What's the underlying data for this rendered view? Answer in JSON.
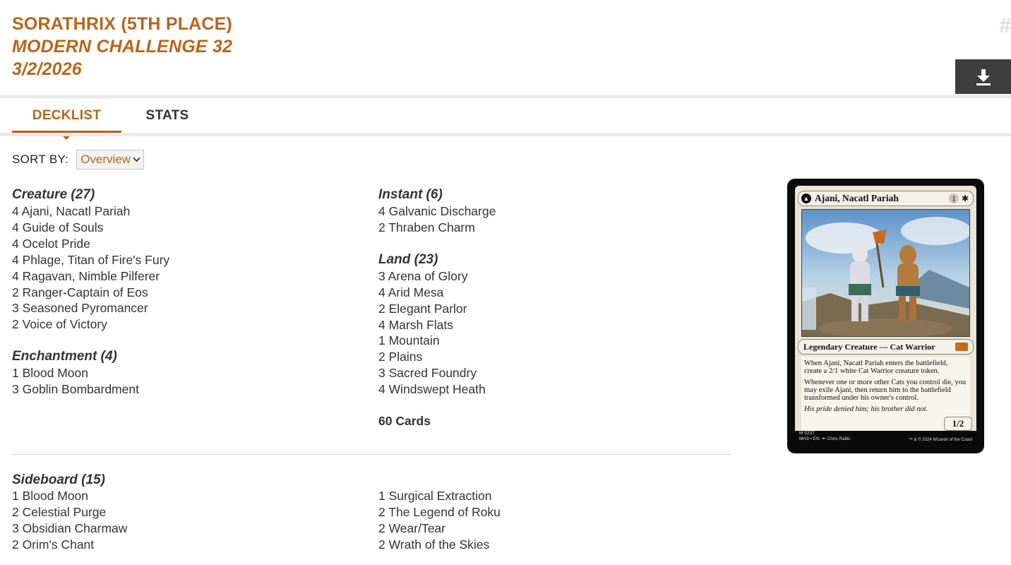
{
  "header": {
    "player": "SORATHRIX (5TH PLACE)",
    "event": "MODERN CHALLENGE 32",
    "date": "3/2/2026",
    "hash": "#"
  },
  "tabs": [
    {
      "label": "DECKLIST",
      "active": true
    },
    {
      "label": "STATS",
      "active": false
    }
  ],
  "sort": {
    "label": "SORT BY:",
    "selected": "Overview"
  },
  "maindeck": {
    "column1": [
      {
        "title": "Creature (27)",
        "cards": [
          "4 Ajani, Nacatl Pariah",
          "4 Guide of Souls",
          "4 Ocelot Pride",
          "4 Phlage, Titan of Fire's Fury",
          "4 Ragavan, Nimble Pilferer",
          "2 Ranger-Captain of Eos",
          "3 Seasoned Pyromancer",
          "2 Voice of Victory"
        ]
      },
      {
        "title": "Enchantment (4)",
        "cards": [
          "1 Blood Moon",
          "3 Goblin Bombardment"
        ]
      }
    ],
    "column2": [
      {
        "title": "Instant (6)",
        "cards": [
          "4 Galvanic Discharge",
          "2 Thraben Charm"
        ]
      },
      {
        "title": "Land (23)",
        "cards": [
          "3 Arena of Glory",
          "4 Arid Mesa",
          "2 Elegant Parlor",
          "4 Marsh Flats",
          "1 Mountain",
          "2 Plains",
          "3 Sacred Foundry",
          "4 Windswept Heath"
        ]
      }
    ],
    "total": "60 Cards"
  },
  "sideboard": {
    "title": "Sideboard (15)",
    "column1": [
      "1 Blood Moon",
      "2 Celestial Purge",
      "3 Obsidian Charmaw",
      "2 Orim's Chant"
    ],
    "column2": [
      "1 Surgical Extraction",
      "2 The Legend of Roku",
      "2 Wear/Tear",
      "2 Wrath of the Skies"
    ]
  },
  "card_preview": {
    "name": "Ajani, Nacatl Pariah",
    "mana": [
      "1",
      "✱"
    ],
    "type_line": "Legendary Creature — Cat Warrior",
    "rules": [
      "When Ajani, Nacatl Pariah enters the battlefield, create a 2/1 white Cat Warrior creature token.",
      "Whenever one or more other Cats you control die, you may exile Ajani, then return him to the battlefield transformed under his owner's control."
    ],
    "flavor": "His pride denied him; his brother did not.",
    "pt": "1/2",
    "footer_left": "M 0237\nMH3 • EN  ✒ Chris Rallis",
    "footer_right": "™ & © 2024 Wizards of the Coast"
  },
  "colors": {
    "accent": "#b8651b",
    "text": "#333333",
    "download_bg": "#3e3e3e"
  },
  "icons": {
    "download": "download-icon",
    "dropdown": "chevron-down-icon"
  }
}
